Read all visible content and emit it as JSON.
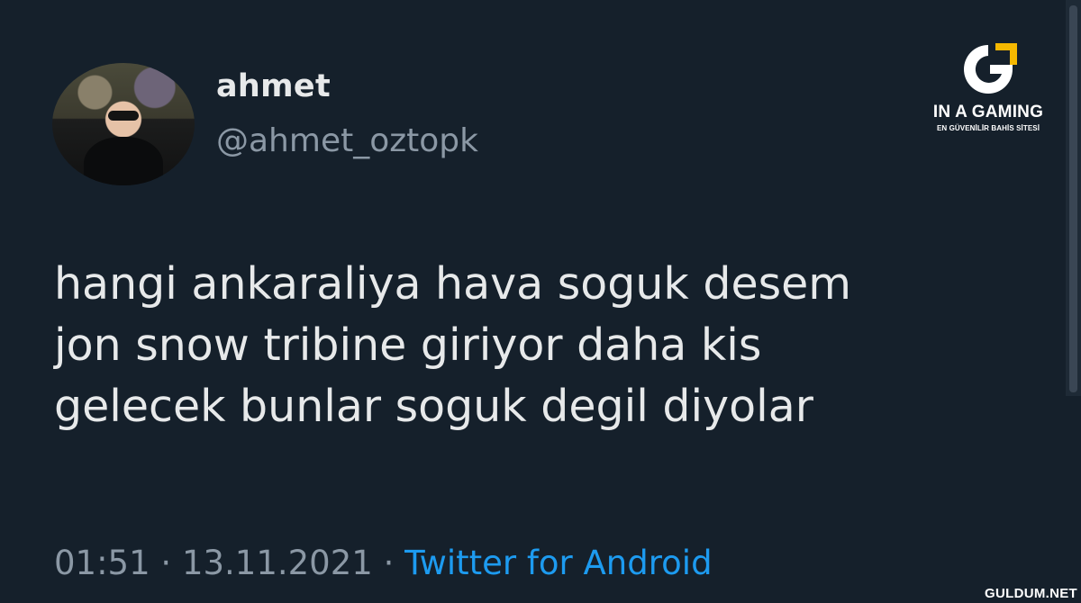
{
  "profile": {
    "name": "ahmet",
    "handle": "@ahmet_oztopk"
  },
  "tweet": {
    "lines": [
      "hangi ankaraliya hava soguk desem",
      "jon snow tribine giriyor daha kis",
      "gelecek bunlar soguk degil diyolar"
    ]
  },
  "meta": {
    "time": "01:51",
    "separator": "·",
    "date": "13.11.2021",
    "source": "Twitter for Android"
  },
  "logo": {
    "brand": "IN A GAMING",
    "tagline": "EN GÜVENİLİR BAHİS SİTESİ",
    "icon": "g-logo-icon",
    "accent": "#f5b800"
  },
  "watermark": "GULDUM.NET",
  "colors": {
    "background": "#15202b",
    "text": "#e7e9ea",
    "secondary": "#8b98a5",
    "link": "#1d9bf0"
  }
}
